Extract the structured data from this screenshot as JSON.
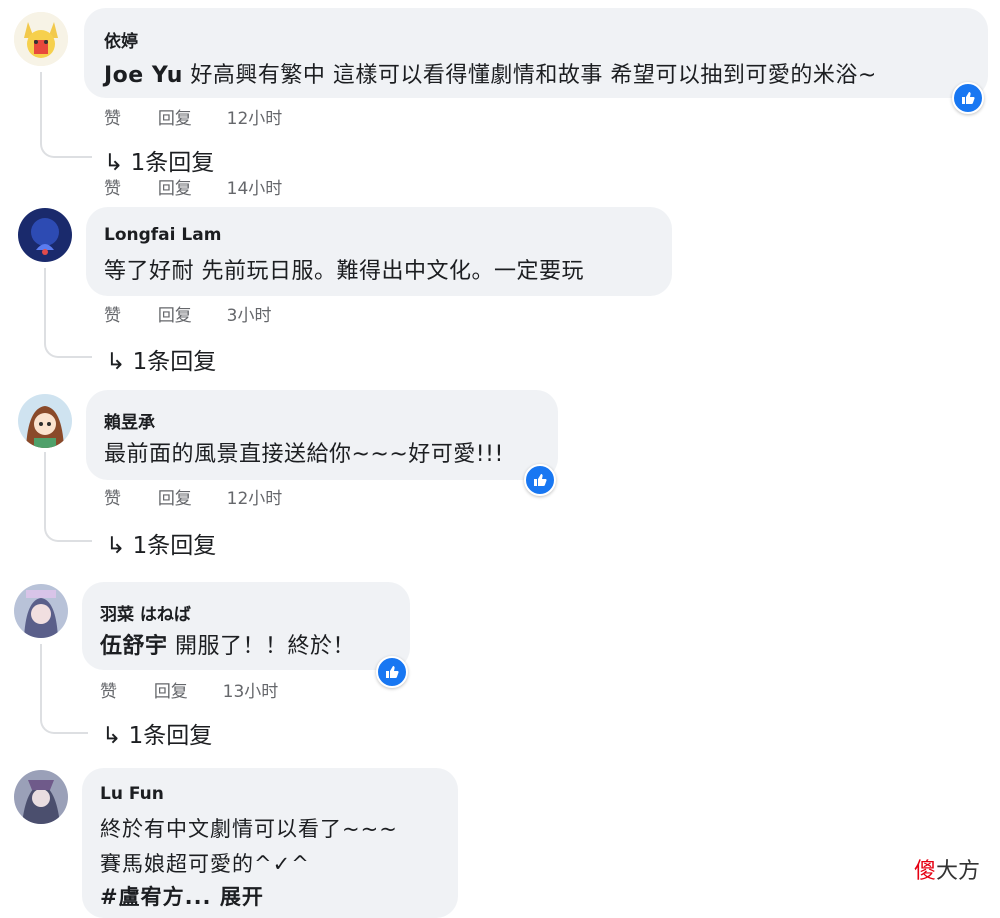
{
  "comments": [
    {
      "author": "依婷",
      "mention": "Joe Yu",
      "text": "好高興有繁中 這樣可以看得懂劇情和故事 希望可以抽到可愛的米浴~",
      "like": "赞",
      "reply": "回复",
      "time": "12小时",
      "replies": "1条回复",
      "sub_like": "赞",
      "sub_reply": "回复",
      "sub_time": "14小时"
    },
    {
      "author": "Longfai Lam",
      "text": "等了好耐 先前玩日服。難得出中文化。一定要玩",
      "like": "赞",
      "reply": "回复",
      "time": "3小时",
      "replies": "1条回复"
    },
    {
      "author": "賴昱承",
      "text": "最前面的風景直接送給你~~~好可愛!!!",
      "like": "赞",
      "reply": "回复",
      "time": "12小时",
      "replies": "1条回复"
    },
    {
      "author": "羽菜 はねば",
      "mention": "伍舒宇",
      "text": "開服了！！終於！",
      "like": "赞",
      "reply": "回复",
      "time": "13小时",
      "replies": "1条回复"
    },
    {
      "author": "Lu Fun",
      "line1": "終於有中文劇情可以看了~~~",
      "line2": "賽馬娘超可愛的^✓^",
      "line3": "#盧宥方... 展开"
    }
  ],
  "watermark": {
    "part1": "傻",
    "part2": "大方"
  },
  "colors": {
    "bubble": "#f0f2f5",
    "like_blue": "#1877f2",
    "meta_gray": "#65676b"
  }
}
